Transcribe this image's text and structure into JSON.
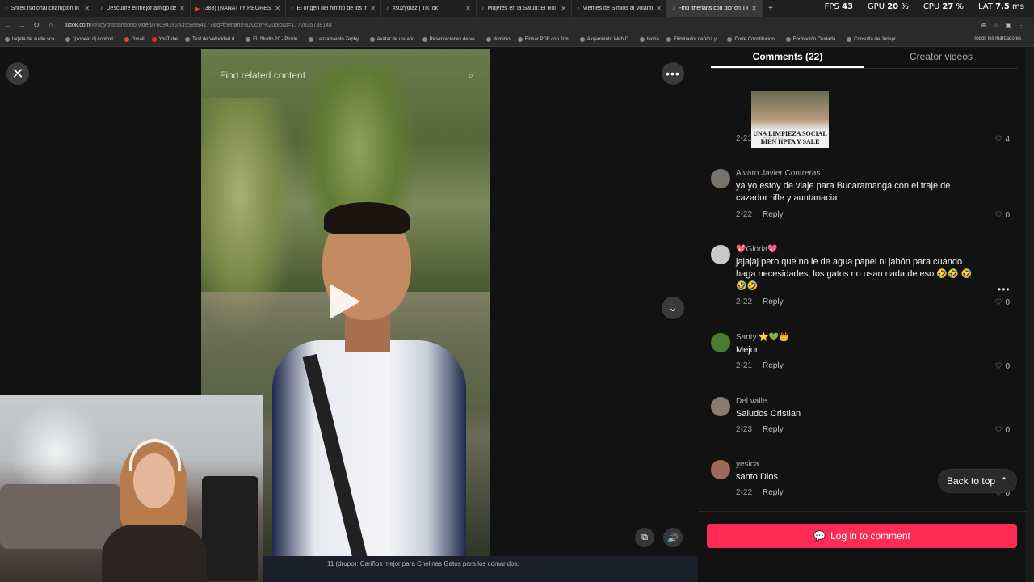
{
  "browser": {
    "tabs": [
      {
        "label": "Shrek national champion in 80",
        "icon": "tiktok-icon"
      },
      {
        "label": "Descubre el mejor amigo de m",
        "icon": "tiktok-icon"
      },
      {
        "label": "(383) (NANATTY REGRESA A JA",
        "icon": "youtube-icon"
      },
      {
        "label": "El origen del himno de los inv",
        "icon": "tiktok-icon"
      },
      {
        "label": "#suzydiaz | TikTok",
        "icon": "tiktok-icon"
      },
      {
        "label": "Mujeres en la Salud: El Rol de l",
        "icon": "tiktok-icon"
      },
      {
        "label": "Viernes de Simios al Volante cr",
        "icon": "tiktok-icon"
      },
      {
        "label": "Find 'therians con pio' on TikTo",
        "icon": "tiktok-icon"
      }
    ],
    "hud": {
      "fps_label": "FPS",
      "fps": "43",
      "gpu_label": "GPU",
      "gpu": "20",
      "cpu_label": "CPU",
      "cpu": "27",
      "lat_label": "LAT",
      "lat": "7.5"
    },
    "url_host": "tiktok.com",
    "url_path": "/@soycristiansorio/video/7609419243558994177&q=therians%20con%20pio&t=1772835788148",
    "bookmarks": [
      "tarjeta de audio sca...",
      "\"pioneer dj controll...",
      "Gmail",
      "YouTube",
      "Test de Velocidad d...",
      "FL Studio 20 - Produ...",
      "Lanzamiento Zephy...",
      "Avatar de usuario",
      "Reservaciones de ve...",
      "dominio",
      "Firmar PDF con firm...",
      "Alojamiento Web C...",
      "teoria",
      "Eliminador de Voz y...",
      "Corte Constitucion...",
      "Formación Ciudada...",
      "Consulta de Jurispr..."
    ],
    "bookmarks_all": "Todos los marcadores"
  },
  "video": {
    "search_placeholder": "Find related content",
    "strip_text": "11 (drupo): Cariños mejor para Chelinas Gatos  para los comandos:"
  },
  "panel": {
    "tabs": {
      "comments": "Comments (22)",
      "creator": "Creator videos"
    },
    "meme_text": "UNA LIMPIEZA SOCIAL BIEN HPTA Y SALE",
    "reply_label": "Reply",
    "first": {
      "date": "2-21",
      "likes": "4"
    },
    "comments": [
      {
        "name": "Alvaro Javier Contreras",
        "text": "ya yo estoy de viaje para Bucaramanga con el traje de cazador rifle y auntanacia",
        "date": "2-22",
        "likes": "0"
      },
      {
        "name": "💖Gloria💖",
        "text": "jajajaj pero que no le de agua papel ni jabón para cuando haga necesidades, los gatos no usan nada de eso 🤣🤣 🤣🤣🤣",
        "date": "2-22",
        "likes": "0"
      },
      {
        "name": "Santy ⭐💚👑",
        "text": "Mejor",
        "date": "2-21",
        "likes": "0"
      },
      {
        "name": "Del valle",
        "text": "Saludos Cristian",
        "date": "2-23",
        "likes": "0"
      },
      {
        "name": "yesica",
        "text": "santo Dios",
        "date": "2-22",
        "likes": "0"
      }
    ],
    "back_to_top": "Back to top",
    "login": "Log in to comment"
  },
  "colors": {
    "accent": "#fe2c55",
    "background": "#121212"
  }
}
